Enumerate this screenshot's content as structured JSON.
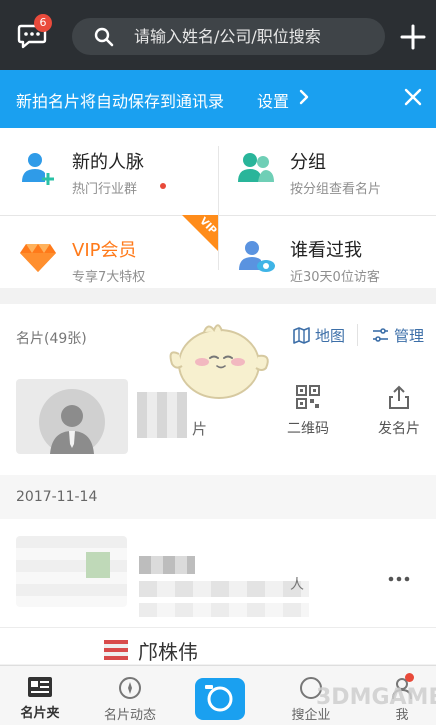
{
  "header": {
    "message_badge": "6",
    "search_placeholder": "请输入姓名/公司/职位搜索"
  },
  "notice": {
    "text": "新拍名片将自动保存到通讯录",
    "settings_label": "设置"
  },
  "menu": {
    "items": [
      {
        "title": "新的人脉",
        "subtitle": "热门行业群",
        "icon": "new-contacts-icon"
      },
      {
        "title": "分组",
        "subtitle": "按分组查看名片",
        "icon": "groups-icon"
      },
      {
        "title": "VIP会员",
        "subtitle": "专享7大特权",
        "icon": "vip-diamond-icon",
        "corner": "VIP"
      },
      {
        "title": "谁看过我",
        "subtitle": "近30天0位访客",
        "icon": "visitors-icon"
      }
    ]
  },
  "cards": {
    "count_label": "名片(49张)",
    "map_label": "地图",
    "manage_label": "管理",
    "my_card_label": "片",
    "actions": [
      {
        "label": "二维码",
        "icon": "qrcode-icon"
      },
      {
        "label": "发名片",
        "icon": "share-icon"
      }
    ],
    "date": "2017-11-14",
    "row_text": "人",
    "row2_name": "邝株伟"
  },
  "bottom_nav": {
    "tabs": [
      {
        "label": "名片夹",
        "icon": "card-folder-icon"
      },
      {
        "label": "名片动态",
        "icon": "feed-icon"
      },
      {
        "label": "",
        "icon": "camera-icon"
      },
      {
        "label": "搜企业",
        "icon": "search-company-icon"
      },
      {
        "label": "我",
        "icon": "profile-icon"
      }
    ]
  },
  "watermark": "3DMGAME",
  "colors": {
    "topbar": "#2b2f33",
    "accent_blue": "#1aa0f0",
    "vip_orange": "#ff7a1a",
    "badge_red": "#ea4b3c"
  }
}
